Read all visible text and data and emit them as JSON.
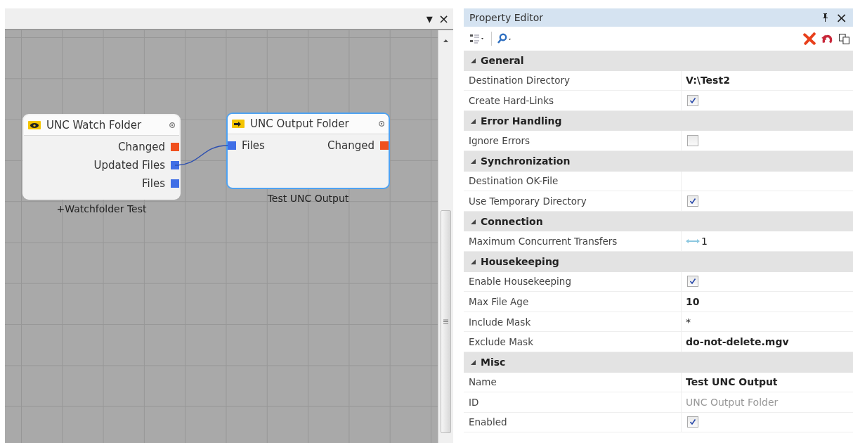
{
  "canvas_panel": {
    "header_buttons": [
      "▾",
      "×"
    ],
    "nodes": [
      {
        "kind": "watch",
        "title": "UNC Watch Folder",
        "selected": false,
        "caption": "+Watchfolder Test",
        "outputs": [
          {
            "label": "Changed",
            "color": "#f0501e",
            "connected": false
          },
          {
            "label": "Updated Files",
            "color": "#3f6ee6",
            "connected": true
          },
          {
            "label": "Files",
            "color": "#3f6ee6",
            "connected": false
          }
        ]
      },
      {
        "kind": "output",
        "title": "UNC Output Folder",
        "selected": true,
        "caption": "Test UNC Output",
        "inputs": [
          {
            "label": "Files",
            "color": "#3f6ee6"
          }
        ],
        "outputs": [
          {
            "label": "Changed",
            "color": "#f0501e",
            "connected": false
          }
        ]
      }
    ]
  },
  "property_editor": {
    "title": "Property Editor",
    "close": "×",
    "categories": [
      {
        "name": "General",
        "expanded": true,
        "rows": [
          {
            "label": "Destination Directory",
            "kind": "text",
            "value": "V:\\Test2"
          },
          {
            "label": "Create Hard-Links",
            "kind": "checkbox",
            "checked": true
          }
        ]
      },
      {
        "name": "Error Handling",
        "expanded": true,
        "rows": [
          {
            "label": "Ignore Errors",
            "kind": "checkbox",
            "checked": false
          }
        ]
      },
      {
        "name": "Synchronization",
        "expanded": true,
        "rows": [
          {
            "label": "Destination OK-File",
            "kind": "empty"
          },
          {
            "label": "Use Temporary Directory",
            "kind": "checkbox",
            "checked": true
          }
        ]
      },
      {
        "name": "Connection",
        "expanded": true,
        "rows": [
          {
            "label": "Maximum Concurrent Transfers",
            "kind": "spinner",
            "value": "1"
          }
        ]
      },
      {
        "name": "Housekeeping",
        "expanded": true,
        "rows": [
          {
            "label": "Enable Housekeeping",
            "kind": "checkbox",
            "checked": true
          },
          {
            "label": "Max File Age",
            "kind": "text",
            "value": "10"
          },
          {
            "label": "Include Mask",
            "kind": "plain",
            "value": "*"
          },
          {
            "label": "Exclude Mask",
            "kind": "text",
            "value": "do-not-delete.mgv"
          }
        ]
      },
      {
        "name": "Misc",
        "expanded": true,
        "rows": [
          {
            "label": "Name",
            "kind": "text",
            "value": "Test UNC Output"
          },
          {
            "label": "ID",
            "kind": "dim",
            "value": "UNC Output Folder"
          },
          {
            "label": "Enabled",
            "kind": "checkbox",
            "checked": true
          }
        ]
      }
    ]
  }
}
